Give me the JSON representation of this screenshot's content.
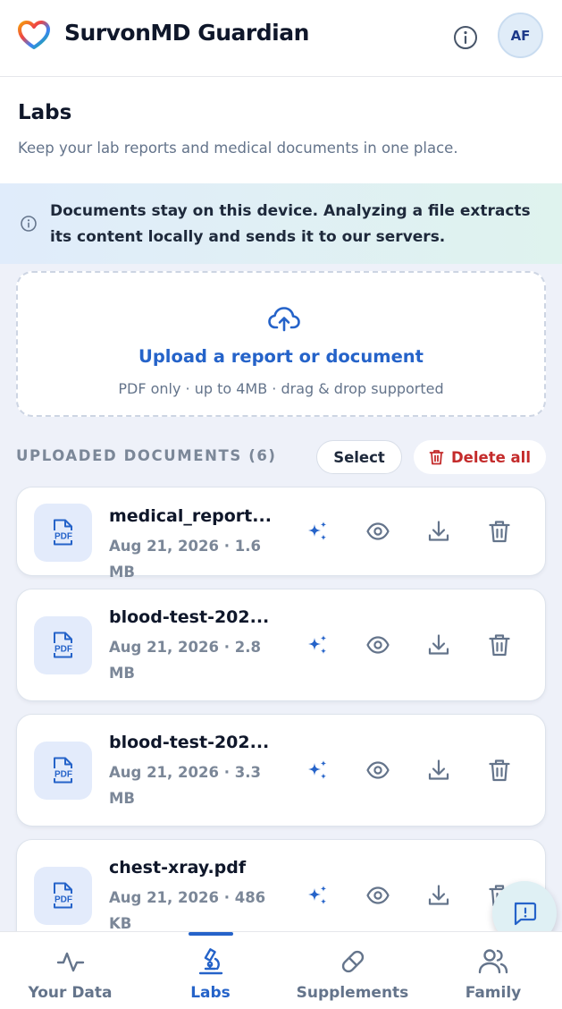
{
  "header": {
    "app_title": "SurvonMD Guardian",
    "avatar_initials": "AF"
  },
  "page": {
    "title": "Labs",
    "subtitle": "Keep your lab reports and medical documents in one place."
  },
  "banner": {
    "text": "Documents stay on this device. Analyzing a file extracts its content locally and sends it to our servers."
  },
  "upload": {
    "title": "Upload a report or document",
    "subtitle": "PDF only · up to 4MB · drag & drop supported"
  },
  "documents": {
    "section_label": "UPLOADED DOCUMENTS (6)",
    "select_label": "Select",
    "delete_all_label": "Delete all",
    "file_badge": "PDF",
    "items": [
      {
        "name": "medical_report...",
        "meta": "Aug 21, 2026 · 1.6 MB"
      },
      {
        "name": "blood-test-202...",
        "meta": "Aug 21, 2026 · 2.8 MB"
      },
      {
        "name": "blood-test-202...",
        "meta": "Aug 21, 2026 · 3.3 MB"
      },
      {
        "name": "chest-xray.pdf",
        "meta": "Aug 21, 2026 · 486 KB"
      }
    ]
  },
  "icons": {
    "analyze": "sparkles-icon",
    "view": "eye-icon",
    "download": "download-icon",
    "delete": "trash-icon",
    "upload": "cloud-upload-icon",
    "feedback": "message-alert-icon"
  },
  "nav": {
    "items": [
      {
        "label": "Your Data"
      },
      {
        "label": "Labs"
      },
      {
        "label": "Supplements"
      },
      {
        "label": "Family"
      }
    ],
    "active": "Labs"
  },
  "colors": {
    "accent": "#2563c9",
    "danger": "#c42b2b",
    "muted": "#64748b"
  }
}
